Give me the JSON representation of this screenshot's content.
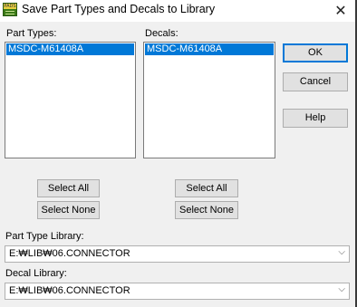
{
  "window": {
    "title": "Save Part Types and Decals to Library",
    "close_glyph": "✕",
    "app_icon_text": "PADS"
  },
  "part_types": {
    "label": "Part Types:",
    "items": [
      "MSDC-M61408A"
    ],
    "select_all_label": "Select All",
    "select_none_label": "Select None"
  },
  "decals": {
    "label": "Decals:",
    "items": [
      "MSDC-M61408A"
    ],
    "select_all_label": "Select All",
    "select_none_label": "Select None"
  },
  "actions": {
    "ok_label": "OK",
    "cancel_label": "Cancel",
    "help_label": "Help"
  },
  "part_type_library": {
    "label": "Part Type Library:",
    "value": "E:₩LIB₩06.CONNECTOR"
  },
  "decal_library": {
    "label": "Decal Library:",
    "value": "E:₩LIB₩06.CONNECTOR"
  },
  "colors": {
    "selection": "#0078d7",
    "dialog_bg": "#f0f0f0",
    "button_bg": "#e1e1e1"
  }
}
